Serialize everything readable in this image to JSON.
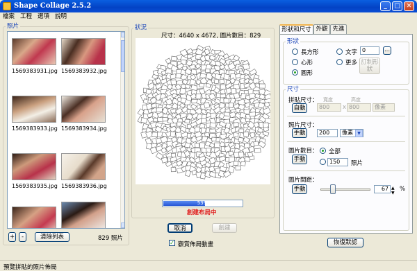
{
  "window": {
    "title": "Shape Collage 2.5.2"
  },
  "menu": [
    "檔案",
    "工程",
    "選項",
    "說明"
  ],
  "photos_panel": {
    "label": "照片",
    "thumbnails": [
      {
        "caption": "1569383931.jpg"
      },
      {
        "caption": "1569383932.jpg"
      },
      {
        "caption": "1569383933.jpg"
      },
      {
        "caption": "1569383934.jpg"
      },
      {
        "caption": "1569383935.jpg"
      },
      {
        "caption": "1569383936.jpg"
      },
      {
        "caption": ""
      },
      {
        "caption": ""
      }
    ],
    "add_label": "+",
    "remove_label": "-",
    "clear_label": "清除列表",
    "count": "829 照片"
  },
  "status_panel": {
    "label": "狀況",
    "info": "尺寸：4640 x 4672, 圖片數目：829",
    "progress_value": 53,
    "progress_text": "53%",
    "message": "創建布局中",
    "cancel_label": "取消",
    "create_label": "創建",
    "watch_label": "觀賞佈局動畫"
  },
  "tabs": [
    "形狀和尺寸",
    "外觀",
    "先進"
  ],
  "shape": {
    "label": "形狀",
    "options": {
      "rect": "長方形",
      "text": "文字",
      "heart": "心形",
      "more": "更多",
      "circle": "圓形"
    },
    "text_value": "0",
    "browse_label": "...",
    "custom_label": "訂制形狀"
  },
  "size": {
    "label": "尺寸",
    "collage_size_label": "拼貼尺寸：",
    "auto_label": "自動",
    "width_label": "寬度",
    "height_label": "高度",
    "width_value": "800",
    "height_value": "800",
    "times": "x",
    "unit_disabled": "像素",
    "photo_size_label": "照片尺寸：",
    "manual_label": "手動",
    "photo_size_value": "200",
    "photo_unit": "像素",
    "count_label": "圖片數目：",
    "count_manual": "手動",
    "all_label": "全部",
    "count_value": "150",
    "count_unit": "照片",
    "spacing_label": "圖片間距：",
    "spacing_manual": "手動",
    "spacing_value": "67",
    "spacing_level": 0.2,
    "spacing_unit": "%"
  },
  "restore_label": "恢復默認",
  "statusbar": "預覽拼貼的照片佈局",
  "colors": {
    "accent": "#1a45b8",
    "error": "#e02020"
  }
}
